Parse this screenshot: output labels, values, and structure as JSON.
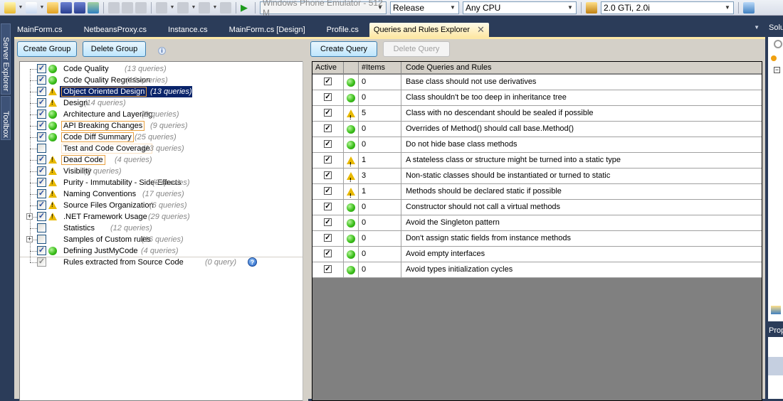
{
  "toolbar": {
    "icons": [
      "new-project-icon",
      "add-item-icon",
      "open-icon",
      "save-icon",
      "save-all-icon",
      "publish-icon",
      "cut-icon",
      "copy-icon",
      "paste-icon",
      "undo-icon",
      "redo-icon",
      "navigate-back-icon",
      "navigate-forward-icon",
      "start-debug-icon"
    ],
    "device_combo": "Windows Phone Emulator - 512 M",
    "config_combo": "Release",
    "platform_combo": "Any CPU",
    "find_combo": "2.0 GTi, 2.0i"
  },
  "tabs": [
    {
      "label": "MainForm.cs"
    },
    {
      "label": "NetbeansProxy.cs"
    },
    {
      "label": "Instance.cs"
    },
    {
      "label": "MainForm.cs [Design]"
    },
    {
      "label": "Profile.cs"
    },
    {
      "label": "Queries and Rules Explorer",
      "active": true
    }
  ],
  "side_strip": {
    "server_explorer": "Server Explorer",
    "toolbox": "Toolbox"
  },
  "right_panels": {
    "solution": "Solu",
    "properties": "Prop"
  },
  "left_pane": {
    "create_group": "Create Group",
    "delete_group": "Delete Group",
    "groups": [
      {
        "name": "Code Quality",
        "count": "(13 queries)",
        "checked": true,
        "status": "ok"
      },
      {
        "name": "Code Quality Regression",
        "count": "(12 queries)",
        "checked": true,
        "status": "ok"
      },
      {
        "name": "Object Oriented Design",
        "count": "(13 queries)",
        "checked": true,
        "status": "warn",
        "selected": true
      },
      {
        "name": "Design",
        "count": "(14 queries)",
        "checked": true,
        "status": "warn"
      },
      {
        "name": "Architecture and Layering",
        "count": "(9 queries)",
        "checked": true,
        "status": "ok"
      },
      {
        "name": "API Breaking Changes",
        "count": "(9 queries)",
        "checked": true,
        "status": "ok"
      },
      {
        "name": "Code Diff Summary",
        "count": "(25 queries)",
        "checked": true,
        "status": "ok"
      },
      {
        "name": "Test and Code Coverage",
        "count": "(13 queries)",
        "checked": false,
        "status": "none"
      },
      {
        "name": "Dead Code",
        "count": "(4 queries)",
        "checked": true,
        "status": "warn"
      },
      {
        "name": "Visibility",
        "count": "(8 queries)",
        "checked": true,
        "status": "warn"
      },
      {
        "name": "Purity - Immutability - Side-Effects",
        "count": "(9 queries)",
        "checked": true,
        "status": "warn"
      },
      {
        "name": "Naming Conventions",
        "count": "(17 queries)",
        "checked": true,
        "status": "warn"
      },
      {
        "name": "Source Files Organization",
        "count": "(6 queries)",
        "checked": true,
        "status": "warn"
      },
      {
        "name": ".NET Framework Usage",
        "count": "(29 queries)",
        "checked": true,
        "status": "warn",
        "expandable": true
      },
      {
        "name": "Statistics",
        "count": "(12 queries)",
        "checked": false,
        "status": "none"
      },
      {
        "name": "Samples of Custom rules",
        "count": "(16 queries)",
        "checked": false,
        "status": "none",
        "expandable": true
      },
      {
        "name": "Defining JustMyCode",
        "count": "(4 queries)",
        "checked": true,
        "status": "ok"
      },
      {
        "name": "Rules extracted from Source Code",
        "count": "(0 query)",
        "checked": true,
        "status": "none",
        "grey": true
      }
    ]
  },
  "right_pane": {
    "create_query": "Create Query",
    "delete_query": "Delete Query",
    "columns": [
      "Active",
      "",
      "#Items",
      "Code Queries and Rules"
    ],
    "rows": [
      {
        "active": true,
        "status": "ok",
        "items": "0",
        "name": "Base class should not use derivatives"
      },
      {
        "active": true,
        "status": "ok",
        "items": "0",
        "name": "Class shouldn't be too deep in inheritance tree"
      },
      {
        "active": true,
        "status": "warn",
        "items": "5",
        "name": "Class with no descendant should be sealed if possible"
      },
      {
        "active": true,
        "status": "ok",
        "items": "0",
        "name": "Overrides of Method() should call base.Method()"
      },
      {
        "active": true,
        "status": "ok",
        "items": "0",
        "name": "Do not hide base class methods"
      },
      {
        "active": true,
        "status": "warn",
        "items": "1",
        "name": "A stateless class or structure might be turned into a static type"
      },
      {
        "active": true,
        "status": "warn",
        "items": "3",
        "name": "Non-static classes should be instantiated or turned to static"
      },
      {
        "active": true,
        "status": "warn",
        "items": "1",
        "name": "Methods should be declared static if possible"
      },
      {
        "active": true,
        "status": "ok",
        "items": "0",
        "name": "Constructor should not call a virtual methods"
      },
      {
        "active": true,
        "status": "ok",
        "items": "0",
        "name": "Avoid the Singleton pattern"
      },
      {
        "active": true,
        "status": "ok",
        "items": "0",
        "name": "Don't assign static fields from instance methods"
      },
      {
        "active": true,
        "status": "ok",
        "items": "0",
        "name": "Avoid empty interfaces"
      },
      {
        "active": true,
        "status": "ok",
        "items": "0",
        "name": "Avoid types initialization cycles"
      }
    ]
  }
}
